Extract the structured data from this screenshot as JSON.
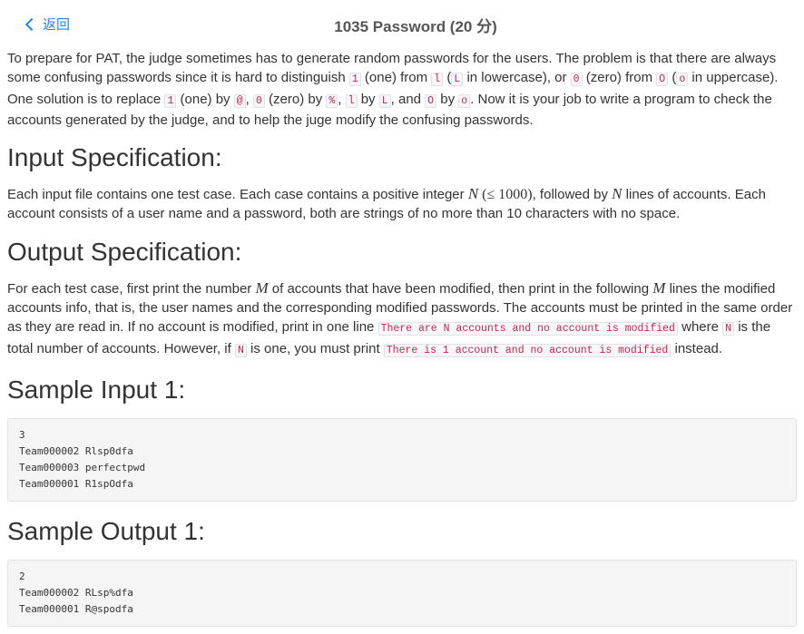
{
  "header": {
    "back_label": "返回",
    "title": "1035 Password (20 分)"
  },
  "intro": {
    "t1": "To prepare for PAT, the judge sometimes has to generate random passwords for the users. The problem is that there are always some confusing passwords since it is hard to distinguish ",
    "c1": "1",
    "t2": " (one) from ",
    "c2": "l",
    "t3": " (",
    "c3": "L",
    "t4": " in lowercase), or ",
    "c4": "0",
    "t5": " (zero) from ",
    "c5": "O",
    "t6": " (",
    "c6": "o",
    "t7": " in uppercase). One solution is to replace ",
    "c7": "1",
    "t8": " (one) by ",
    "c8": "@",
    "t9": ", ",
    "c9": "0",
    "t10": " (zero) by ",
    "c10": "%",
    "t11": ", ",
    "c11": "l",
    "t12": " by ",
    "c12": "L",
    "t13": ", and ",
    "c13": "O",
    "t14": " by ",
    "c14": "o",
    "t15": ". Now it is your job to write a program to check the accounts generated by the judge, and to help the juge modify the confusing passwords."
  },
  "input_spec": {
    "heading": "Input Specification:",
    "t1": "Each input file contains one test case. Each case contains a positive integer ",
    "m1": "N",
    "m2": " (≤ 1000)",
    "t2": ", followed by ",
    "m3": "N",
    "t3": " lines of accounts. Each account consists of a user name and a password, both are strings of no more than 10 characters with no space."
  },
  "output_spec": {
    "heading": "Output Specification:",
    "t1": "For each test case, first print the number ",
    "m1": "M",
    "t2": " of accounts that have been modified, then print in the following ",
    "m2": "M",
    "t3": " lines the modified accounts info, that is, the user names and the corresponding modified passwords. The accounts must be printed in the same order as they are read in. If no account is modified, print in one line ",
    "c1": "There are N accounts and no account is modified",
    "t4": " where ",
    "c2": "N",
    "t5": " is the total number of accounts. However, if ",
    "c3": "N",
    "t6": " is one, you must print ",
    "c4": "There is 1 account and no account is modified",
    "t7": " instead."
  },
  "sample_input": {
    "heading": "Sample Input 1:",
    "lines": [
      "3",
      "Team000002 Rlsp0dfa",
      "Team000003 perfectpwd",
      "Team000001 R1spOdfa"
    ]
  },
  "sample_output": {
    "heading": "Sample Output 1:",
    "lines": [
      "2",
      "Team000002 RLsp%dfa",
      "Team000001 R@spodfa"
    ]
  }
}
